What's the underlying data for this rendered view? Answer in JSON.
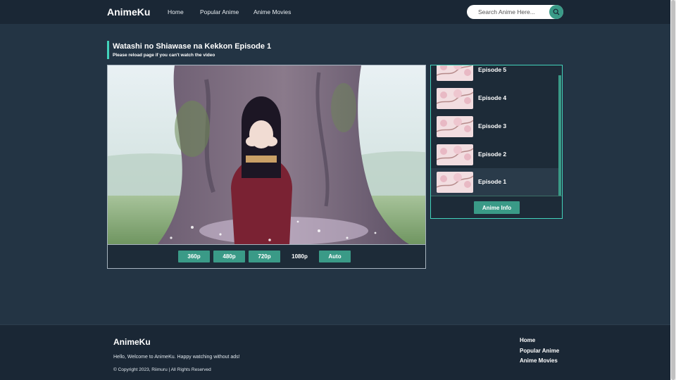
{
  "navbar": {
    "brand": "AnimeKu",
    "links": [
      "Home",
      "Popular Anime",
      "Anime Movies"
    ],
    "search_placeholder": "Search Anime Here...",
    "search_icon": "search-icon"
  },
  "episode": {
    "title": "Watashi no Shiawase na Kekkon Episode 1",
    "note": "Please reload page if you can't watch the video"
  },
  "player": {
    "qualities": [
      "360p",
      "480p",
      "720p",
      "1080p",
      "Auto"
    ],
    "selected_quality": "1080p"
  },
  "episode_list": {
    "items": [
      {
        "label": "Episode 5"
      },
      {
        "label": "Episode 4"
      },
      {
        "label": "Episode 3"
      },
      {
        "label": "Episode 2"
      },
      {
        "label": "Episode 1"
      }
    ],
    "current": "Episode 1",
    "info_button": "Anime Info"
  },
  "footer": {
    "brand": "AnimeKu",
    "welcome": "Hello, Welcome to AnimeKu. Happy watching without ads!",
    "copyright": "© Copyright 2023, Riimuru | All Rights Reserved",
    "links": [
      "Home",
      "Popular Anime",
      "Anime Movies"
    ]
  },
  "colors": {
    "background": "#233444",
    "navbar": "#1a2735",
    "accent": "#3a9a87",
    "accent_border": "#42d3bb"
  }
}
